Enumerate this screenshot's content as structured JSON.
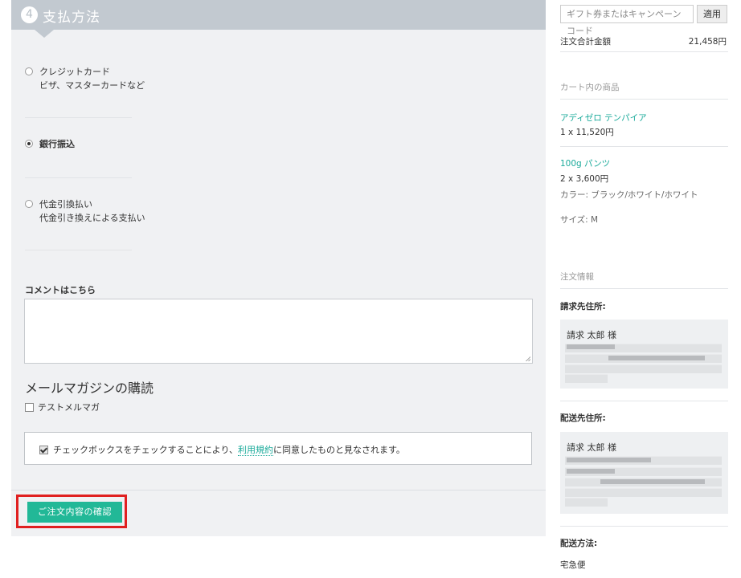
{
  "step": {
    "number": "4",
    "title": "支払方法"
  },
  "payment_options": [
    {
      "label": "クレジットカード",
      "sub": "ビザ、マスターカードなど",
      "selected": false
    },
    {
      "label": "銀行振込",
      "sub": "",
      "selected": true
    },
    {
      "label": "代金引換払い",
      "sub": "代金引き換えによる支払い",
      "selected": false
    }
  ],
  "comment": {
    "label": "コメントはこちら",
    "value": ""
  },
  "mail_magazine": {
    "heading": "メールマガジンの購読",
    "option_label": "テストメルマガ",
    "checked": false
  },
  "terms": {
    "checked": true,
    "text_before": "チェックボックスをチェックすることにより、",
    "link_text": "利用規約",
    "text_after": "に同意したものと見なされます。"
  },
  "confirm_button": {
    "label": "ご注文内容の確認"
  },
  "sidebar": {
    "coupon": {
      "placeholder": "ギフト券またはキャンペーンコード",
      "apply_label": "適用"
    },
    "order_total": {
      "label": "注文合計金額",
      "value": "21,458円"
    },
    "cart_heading": "カート内の商品",
    "items": [
      {
        "name": "アディゼロ テンパイア",
        "qty_price": "1 x 11,520円",
        "color": "",
        "size": ""
      },
      {
        "name": "100g パンツ",
        "qty_price": "2 x 3,600円",
        "color": "カラー: ブラック/ホワイト/ホワイト",
        "size": "サイズ: M"
      }
    ],
    "order_info_heading": "注文情報",
    "billing": {
      "heading": "請求先住所:",
      "name": "請求 太郎 様"
    },
    "shipping": {
      "heading": "配送先住所:",
      "name": "請求 太郎 様"
    },
    "delivery": {
      "heading": "配送方法:",
      "value": "宅急便"
    }
  },
  "colors": {
    "accent": "#22b897",
    "link": "#1aaa9a",
    "header": "#c2c9d0",
    "highlight": "#e02020"
  }
}
